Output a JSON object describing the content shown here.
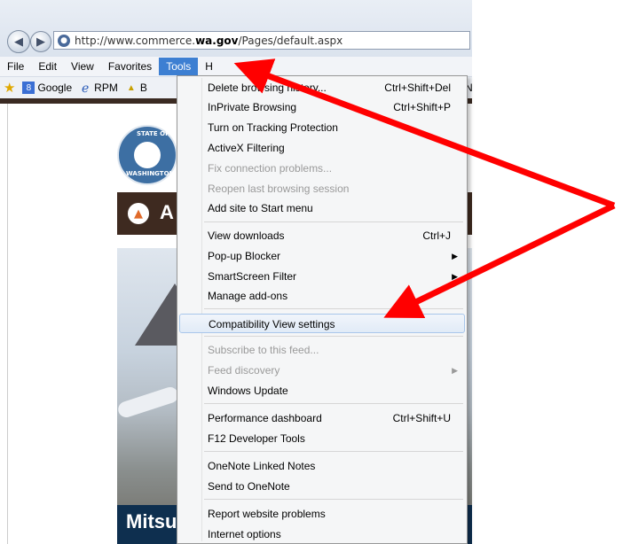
{
  "browser": {
    "address_url_prefix": "http://www.commerce.",
    "address_url_domain": "wa.gov",
    "address_url_suffix": "/Pages/default.aspx",
    "menus": [
      "File",
      "Edit",
      "View",
      "Favorites",
      "Tools",
      "Help"
    ],
    "menu_help_partial": "H",
    "favorites": {
      "google": "Google",
      "rpm": "RPM",
      "partial": "B",
      "partial_right": "N"
    }
  },
  "website": {
    "seal_top": "STATE OF",
    "seal_bottom": "WASHINGTON",
    "banner_text": "A",
    "hero_caption": "Mitsu"
  },
  "tools_menu": {
    "items": [
      {
        "label": "Delete browsing history...",
        "shortcut": "Ctrl+Shift+Del"
      },
      {
        "label": "InPrivate Browsing",
        "shortcut": "Ctrl+Shift+P"
      },
      {
        "label": "Turn on Tracking Protection",
        "shortcut": ""
      },
      {
        "label": "ActiveX Filtering",
        "shortcut": ""
      },
      {
        "label": "Fix connection problems...",
        "shortcut": ""
      },
      {
        "label": "Reopen last browsing session",
        "shortcut": ""
      },
      {
        "label": "Add site to Start menu",
        "shortcut": ""
      },
      {
        "label": "View downloads",
        "shortcut": "Ctrl+J"
      },
      {
        "label": "Pop-up Blocker",
        "shortcut": ""
      },
      {
        "label": "SmartScreen Filter",
        "shortcut": ""
      },
      {
        "label": "Manage add-ons",
        "shortcut": ""
      },
      {
        "label": "Compatibility View settings",
        "shortcut": ""
      },
      {
        "label": "Subscribe to this feed...",
        "shortcut": ""
      },
      {
        "label": "Feed discovery",
        "shortcut": ""
      },
      {
        "label": "Windows Update",
        "shortcut": ""
      },
      {
        "label": "Performance dashboard",
        "shortcut": "Ctrl+Shift+U"
      },
      {
        "label": "F12 Developer Tools",
        "shortcut": ""
      },
      {
        "label": "OneNote Linked Notes",
        "shortcut": ""
      },
      {
        "label": "Send to OneNote",
        "shortcut": ""
      },
      {
        "label": "Report website problems",
        "shortcut": ""
      },
      {
        "label": "Internet options",
        "shortcut": ""
      }
    ]
  },
  "colors": {
    "menu_highlight": "#3d7fd2",
    "annotation_arrow": "#ff0000",
    "banner_brown": "#3e2a20",
    "caption_navy": "#0e2f4f"
  }
}
